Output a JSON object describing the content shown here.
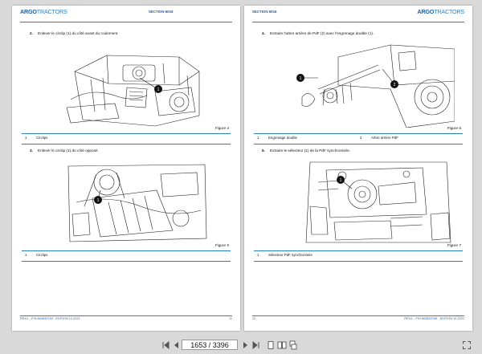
{
  "viewer": {
    "page_indicator": "1653 / 3396",
    "icons": [
      "first-page-icon",
      "previous-page-icon",
      "next-page-icon",
      "last-page-icon",
      "single-page-view-icon",
      "two-page-view-icon",
      "continuous-view-icon",
      "fullscreen-icon"
    ]
  },
  "colors": {
    "accent": "#1f5fa8",
    "rule": "#2e7fc2",
    "callout": "#111111"
  },
  "left_page": {
    "logo_main": "ARGO",
    "logo_sub": "TRACTORS",
    "section": "SECTION 6016",
    "step2": {
      "num": "2.",
      "text": "Enlever le circlip (1) du côté avant du roulement."
    },
    "figure4": {
      "label": "Figure 4",
      "callout": "1"
    },
    "legend4": [
      {
        "num": "1",
        "text": "Circlips"
      }
    ],
    "step3": {
      "num": "3.",
      "text": "Enlever le circlip (1) du côté opposé."
    },
    "figure5": {
      "label": "Figure 5",
      "callout": "1"
    },
    "legend5": [
      {
        "num": "1",
        "text": "Circlips"
      }
    ],
    "footer_left": "REX4 – P/N 6638337A9 - EDITION 12-2021",
    "footer_right": "11"
  },
  "right_page": {
    "section": "SECTION 6016",
    "logo_main": "ARGO",
    "logo_sub": "TRACTORS",
    "step4": {
      "num": "4.",
      "text": "Extraire l'arbre arrière de PdF (2) avec l'engrenage double (1)."
    },
    "figure6": {
      "label": "Figure 6",
      "callout1": "1",
      "callout2": "2"
    },
    "legend6": [
      {
        "num": "1",
        "text": "Engrenage double"
      },
      {
        "num": "2",
        "text": "Arbre arrière PdF"
      }
    ],
    "step5": {
      "num": "5.",
      "text": "Extraire le sélecteur (1) de la PdF synchronisée."
    },
    "figure7": {
      "label": "Figure 7",
      "callout": "1"
    },
    "legend7": [
      {
        "num": "1",
        "text": "Sélecteur PdF synchronisée"
      }
    ],
    "footer_left": "12",
    "footer_right": "REX4 – P/N 6638337A9 - EDITION 12-2021"
  }
}
